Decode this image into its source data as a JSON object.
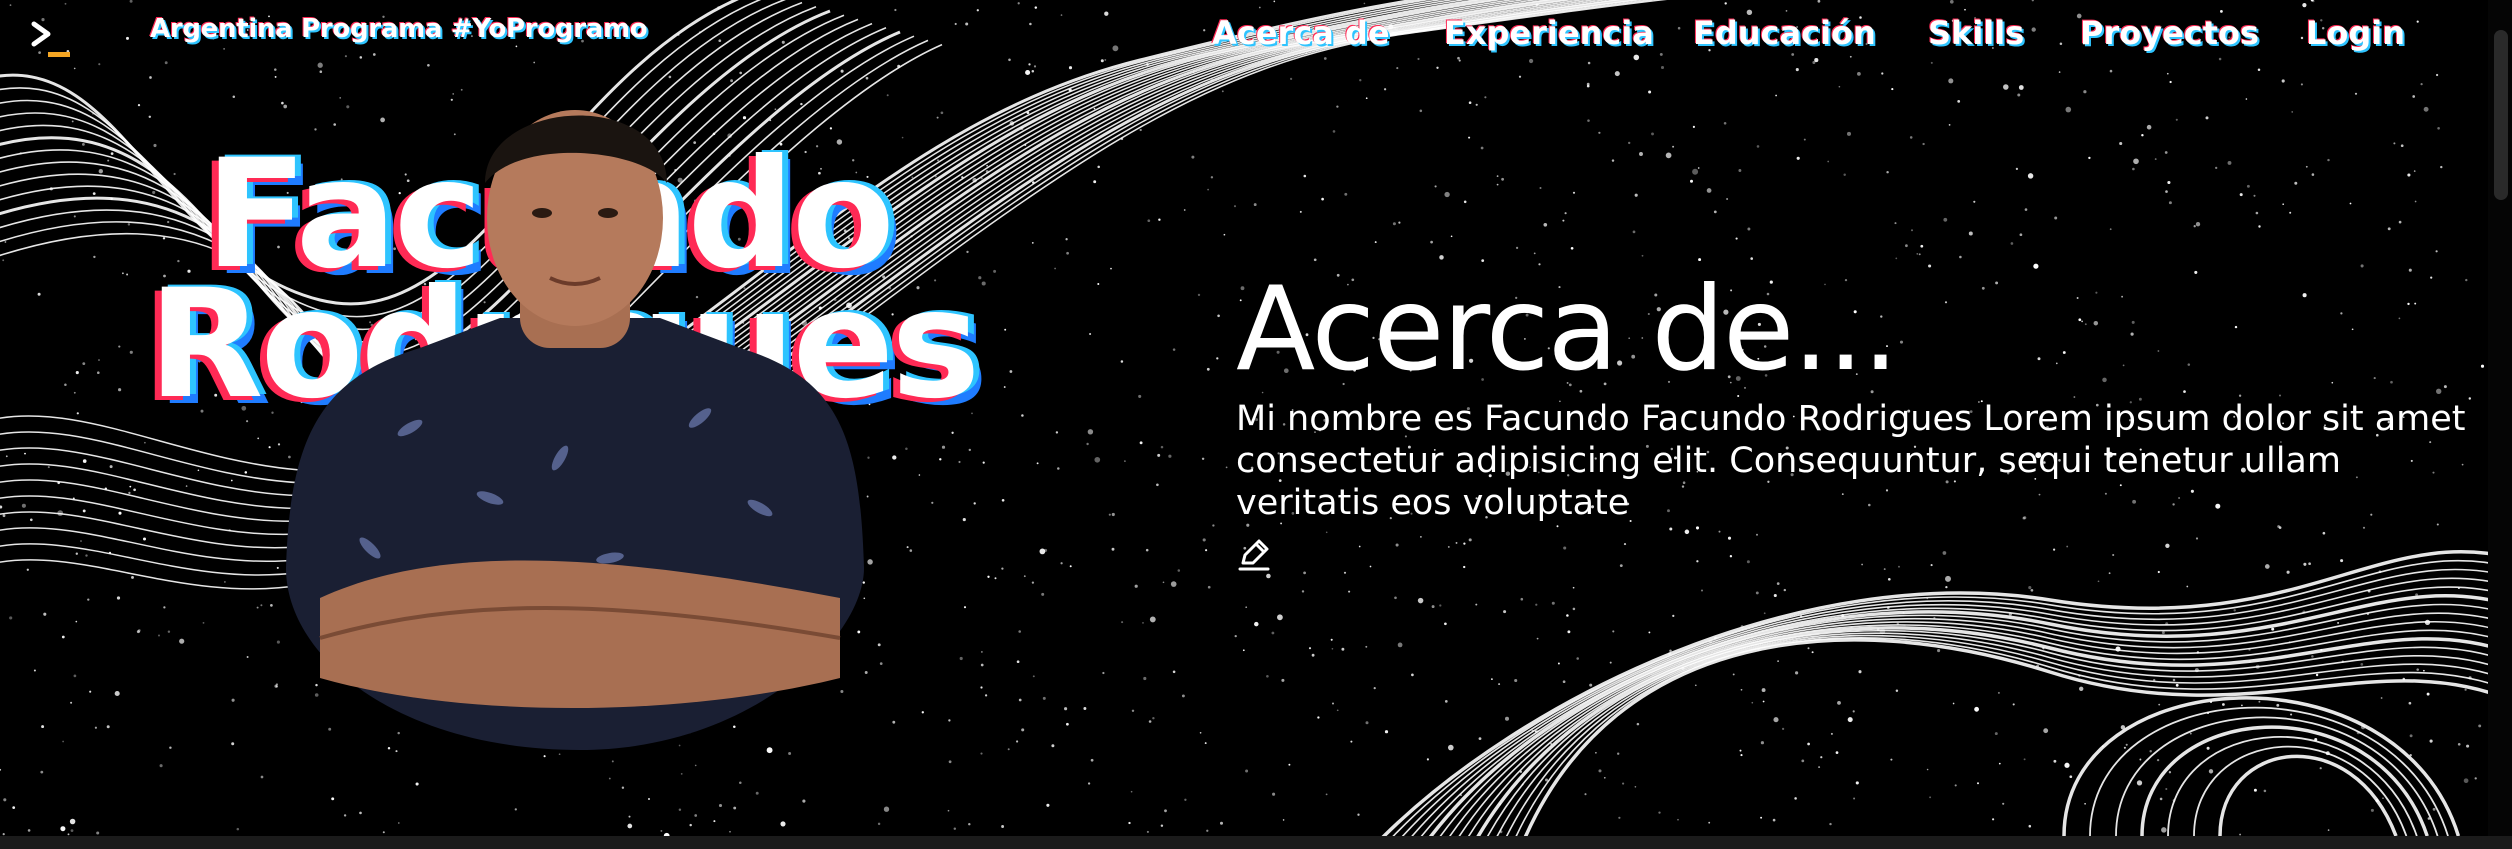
{
  "brand": {
    "text": "Argentina Programa #YoProgramo"
  },
  "nav": [
    {
      "label": "Acerca de"
    },
    {
      "label": "Experiencia"
    },
    {
      "label": "Educación"
    },
    {
      "label": "Skills"
    },
    {
      "label": "Proyectos"
    },
    {
      "label": "Login"
    }
  ],
  "hero": {
    "first_name": "Facundo",
    "last_name": "Rodrigues"
  },
  "about": {
    "title": "Acerca de...",
    "text": "Mi nombre es Facundo Facundo Rodrigues Lorem ipsum dolor sit amet consectetur adipisicing elit. Consequuntur, sequi tenetur ullam veritatis eos voluptate"
  },
  "icons": {
    "logo": "terminal-prompt-icon",
    "edit": "pencil-icon"
  },
  "colors": {
    "background": "#000000",
    "accent_red": "#ff2a55",
    "accent_cyan": "#2ec4ff",
    "logo_cursor": "#f5a623"
  }
}
